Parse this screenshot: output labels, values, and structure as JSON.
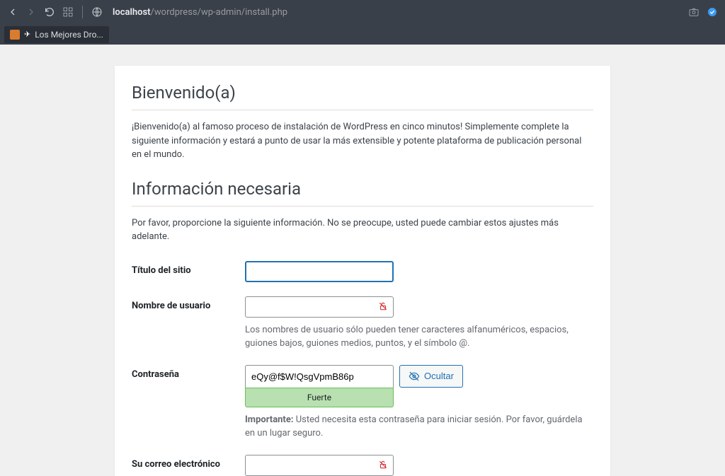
{
  "browser": {
    "url_domain": "localhost",
    "url_path": "/wordpress/wp-admin/install.php",
    "tab_title": "Los Mejores Dro..."
  },
  "install": {
    "welcome_title": "Bienvenido(a)",
    "welcome_text": "¡Bienvenido(a) al famoso proceso de instalación de WordPress en cinco minutos! Simplemente complete la siguiente información y estará a punto de usar la más extensible y potente plataforma de publicación personal en el mundo.",
    "info_title": "Información necesaria",
    "info_text": "Por favor, proporcione la siguiente información. No se preocupe, usted puede cambiar estos ajustes más adelante.",
    "fields": {
      "site_title_label": "Título del sitio",
      "site_title_value": "",
      "username_label": "Nombre de usuario",
      "username_value": "",
      "username_desc": "Los nombres de usuario sólo pueden tener caracteres alfanuméricos, espacios, guiones bajos, guiones medios, puntos, y el símbolo @.",
      "password_label": "Contraseña",
      "password_value": "eQy@f$W!QsgVpmB86p",
      "password_strength": "Fuerte",
      "hide_btn": "Ocultar",
      "password_important_label": "Importante:",
      "password_important_text": " Usted necesita esta contraseña para iniciar sesión. Por favor, guárdela en un lugar seguro.",
      "email_label": "Su correo electrónico",
      "email_value": ""
    }
  }
}
